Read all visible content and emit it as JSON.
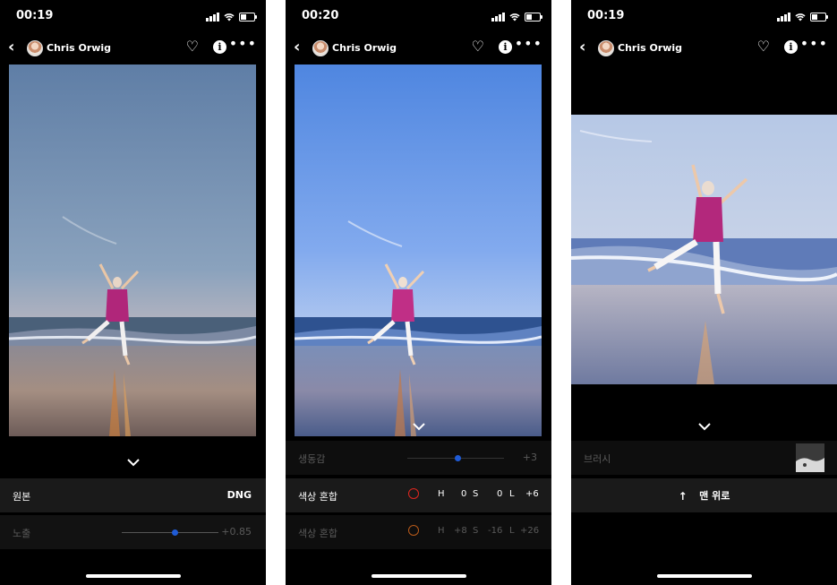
{
  "screens": [
    {
      "time": "00:19",
      "user": "Chris Orwig",
      "rows": {
        "original_label": "원본",
        "original_value": "DNG",
        "exposure_label": "노출",
        "exposure_value": "+0.85",
        "exposure_level": 0.55
      }
    },
    {
      "time": "00:20",
      "user": "Chris Orwig",
      "rows": {
        "vibrance_label": "생동감",
        "vibrance_value": "+3",
        "vibrance_level": 0.52,
        "mix1_label": "색상 혼합",
        "mix1_h_label": "H",
        "mix1_h": "0",
        "mix1_s_label": "S",
        "mix1_s": "0",
        "mix1_l_label": "L",
        "mix1_l": "+6",
        "mix2_label": "색상 혼합",
        "mix2_h_label": "H",
        "mix2_h": "+8",
        "mix2_s_label": "S",
        "mix2_s": "-16",
        "mix2_l_label": "L",
        "mix2_l": "+26"
      }
    },
    {
      "time": "00:19",
      "user": "Chris Orwig",
      "rows": {
        "brush_label": "브러시",
        "top_button_label": "맨 위로",
        "top_arrow": "↑"
      }
    }
  ],
  "icons": {
    "back": "chevron-left",
    "heart": "heart-outline",
    "info": "info-circle",
    "more": "ellipsis",
    "expand": "chevron-down"
  },
  "colors": {
    "slider_knob": "#1f5bd6",
    "mix1_ring": "#e0261f",
    "mix2_ring": "#b85a1a",
    "background": "#000000"
  }
}
